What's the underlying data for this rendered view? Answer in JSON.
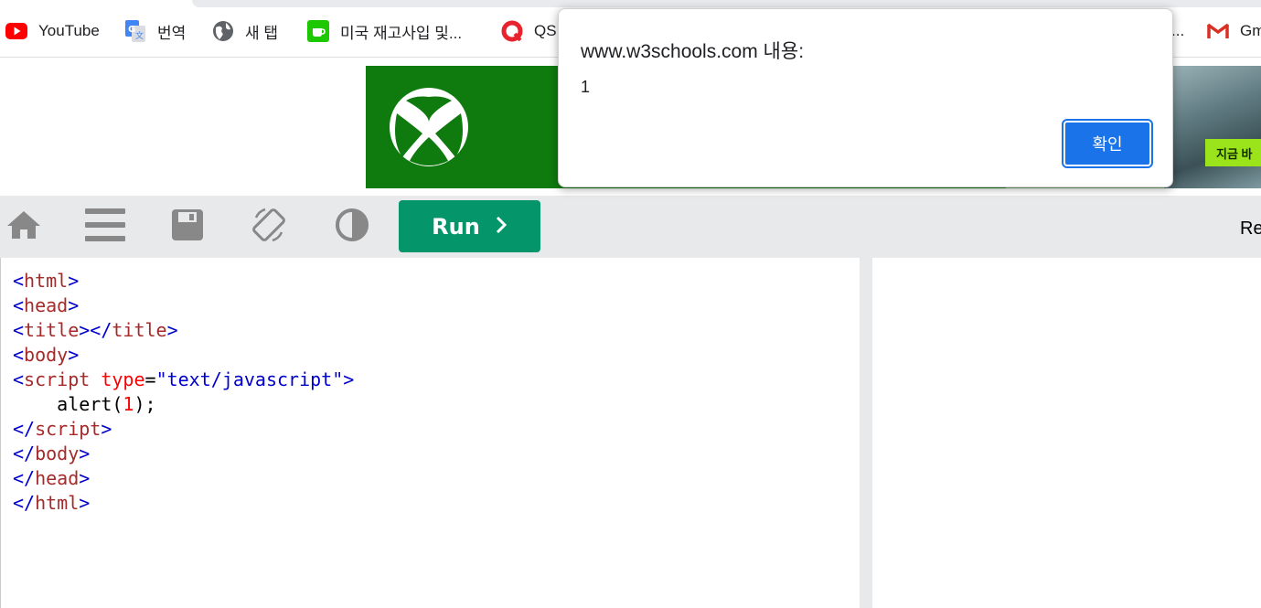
{
  "bookmarks": {
    "items": [
      {
        "label": "YouTube",
        "icon": "youtube-icon"
      },
      {
        "label": "번역",
        "icon": "google-translate-icon"
      },
      {
        "label": "새 탭",
        "icon": "globe-icon"
      },
      {
        "label": "미국 재고사입 및...",
        "icon": "coffee-cup-icon"
      },
      {
        "label": "QS",
        "icon": "q-logo-icon"
      },
      {
        "label": "...",
        "icon": ""
      },
      {
        "label": "Gm",
        "icon": "gmail-icon"
      }
    ]
  },
  "ad": {
    "brand_icon": "xbox-logo-icon",
    "cta_label": "지금 바",
    "colors": {
      "background": "#0f7b0f",
      "cta": "#9be31a"
    }
  },
  "toolbar": {
    "run_label": "Run",
    "run_icon": "chevron-right-icon",
    "result_label": "Re",
    "icons": [
      "home-icon",
      "menu-icon",
      "save-icon",
      "rotate-icon",
      "contrast-icon"
    ],
    "colors": {
      "run": "#04956b",
      "bar": "#e7e9eb"
    }
  },
  "editor": {
    "lines": [
      {
        "open": "<",
        "tag": "html",
        "close": ">"
      },
      {
        "open": "<",
        "tag": "head",
        "close": ">"
      },
      {
        "open": "<",
        "tag": "title",
        "mid": "></",
        "tag2": "title",
        "close": ">"
      },
      {
        "open": "<",
        "tag": "body",
        "close": ">"
      },
      {
        "open": "<",
        "tag": "script",
        "attr": "type",
        "eq": "=",
        "val": "\"text/javascript\"",
        "close": ">"
      },
      {
        "indent": "    ",
        "fn": "alert(",
        "num": "1",
        "end": ");"
      },
      {
        "open": "</",
        "tag": "script",
        "close": ">"
      },
      {
        "open": "</",
        "tag": "body",
        "close": ">"
      },
      {
        "open": "</",
        "tag": "head",
        "close": ">"
      },
      {
        "open": "</",
        "tag": "html",
        "close": ">"
      }
    ]
  },
  "dialog": {
    "title": "www.w3schools.com 내용:",
    "message": "1",
    "ok_label": "확인",
    "colors": {
      "button": "#1a73e8"
    }
  }
}
